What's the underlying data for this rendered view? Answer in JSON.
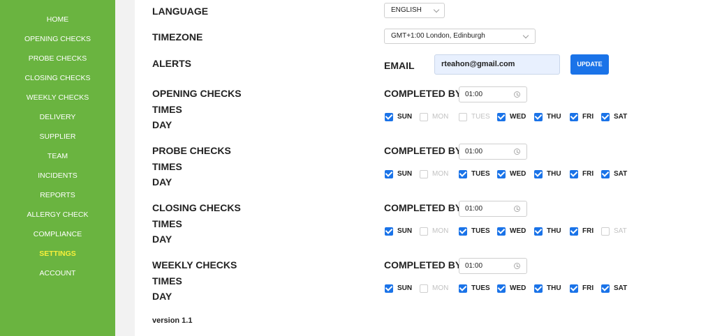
{
  "sidebar": {
    "items": [
      {
        "label": "HOME",
        "active": false
      },
      {
        "label": "OPENING CHECKS",
        "active": false
      },
      {
        "label": "PROBE CHECKS",
        "active": false
      },
      {
        "label": "CLOSING CHECKS",
        "active": false
      },
      {
        "label": "WEEKLY CHECKS",
        "active": false
      },
      {
        "label": "DELIVERY",
        "active": false
      },
      {
        "label": "SUPPLIER",
        "active": false
      },
      {
        "label": "TEAM",
        "active": false
      },
      {
        "label": "INCIDENTS",
        "active": false
      },
      {
        "label": "REPORTS",
        "active": false
      },
      {
        "label": "ALLERGY CHECK",
        "active": false
      },
      {
        "label": "COMPLIANCE",
        "active": false
      },
      {
        "label": "SETTINGS",
        "active": true
      },
      {
        "label": "ACCOUNT",
        "active": false
      }
    ]
  },
  "settings": {
    "language": {
      "label": "LANGUAGE",
      "value": "ENGLISH"
    },
    "timezone": {
      "label": "TIMEZONE",
      "value": "GMT+1:00 London, Edinburgh"
    },
    "alerts": {
      "label": "ALERTS",
      "email_label": "EMAIL",
      "email_value": "rteahon@gmail.com",
      "update_label": "UPDATE"
    }
  },
  "day_labels": [
    "SUN",
    "MON",
    "TUES",
    "WED",
    "THU",
    "FRI",
    "SAT"
  ],
  "checks": [
    {
      "title": "OPENING CHECKS",
      "times_label": "TIMES",
      "day_label": "DAY",
      "completed_label": "COMPLETED BY",
      "time": "01:00",
      "days": [
        true,
        false,
        false,
        true,
        true,
        true,
        true
      ]
    },
    {
      "title": "PROBE CHECKS",
      "times_label": "TIMES",
      "day_label": "DAY",
      "completed_label": "COMPLETED BY",
      "time": "01:00",
      "days": [
        true,
        false,
        true,
        true,
        true,
        true,
        true
      ]
    },
    {
      "title": "CLOSING CHECKS",
      "times_label": "TIMES",
      "day_label": "DAY",
      "completed_label": "COMPLETED BY",
      "time": "01:00",
      "days": [
        true,
        false,
        true,
        true,
        true,
        true,
        false
      ]
    },
    {
      "title": "WEEKLY CHECKS",
      "times_label": "TIMES",
      "day_label": "DAY",
      "completed_label": "COMPLETED BY",
      "time": "01:00",
      "days": [
        true,
        false,
        true,
        true,
        true,
        true,
        true
      ]
    }
  ],
  "footer": {
    "version": "version 1.1"
  },
  "colors": {
    "sidebar_bg": "#6ab440",
    "active_nav": "#f7f03a",
    "accent": "#1a73e8"
  }
}
